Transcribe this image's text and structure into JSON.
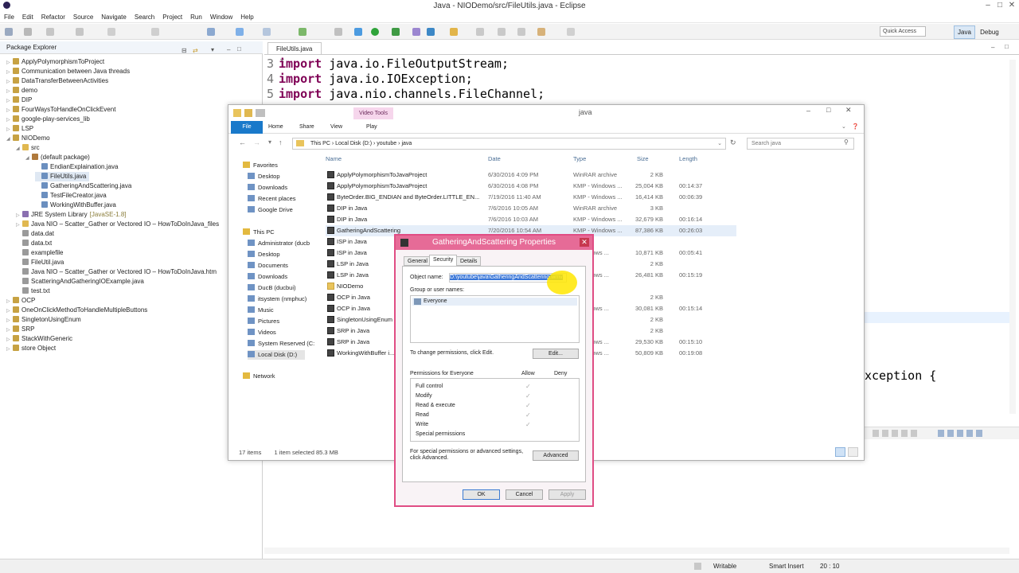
{
  "window": {
    "title": "Java - NIODemo/src/FileUtils.java - Eclipse"
  },
  "menu": [
    "File",
    "Edit",
    "Refactor",
    "Source",
    "Navigate",
    "Search",
    "Project",
    "Run",
    "Window",
    "Help"
  ],
  "quick_access": "Quick Access",
  "perspectives": {
    "java": "Java",
    "debug": "Debug"
  },
  "package_explorer": {
    "title": "Package Explorer",
    "items": [
      {
        "label": "ApplyPolymorphismToProject",
        "depth": 0,
        "kind": "project"
      },
      {
        "label": "Communication between Java threads",
        "depth": 0,
        "kind": "project"
      },
      {
        "label": "DataTransferBetweenActivities",
        "depth": 0,
        "kind": "project"
      },
      {
        "label": "demo",
        "depth": 0,
        "kind": "project"
      },
      {
        "label": "DIP",
        "depth": 0,
        "kind": "project"
      },
      {
        "label": "FourWaysToHandleOnClickEvent",
        "depth": 0,
        "kind": "project"
      },
      {
        "label": "google-play-services_lib",
        "depth": 0,
        "kind": "project"
      },
      {
        "label": "LSP",
        "depth": 0,
        "kind": "project"
      },
      {
        "label": "NIODemo",
        "depth": 0,
        "kind": "project"
      },
      {
        "label": "src",
        "depth": 1,
        "kind": "folder"
      },
      {
        "label": "(default package)",
        "depth": 2,
        "kind": "package"
      },
      {
        "label": "EndianExplaination.java",
        "depth": 3,
        "kind": "java"
      },
      {
        "label": "FileUtils.java",
        "depth": 3,
        "kind": "java",
        "selected": true
      },
      {
        "label": "GatheringAndScattering.java",
        "depth": 3,
        "kind": "java"
      },
      {
        "label": "TestFileCreator.java",
        "depth": 3,
        "kind": "java"
      },
      {
        "label": "WorkingWithBuffer.java",
        "depth": 3,
        "kind": "java"
      },
      {
        "label": "JRE System Library",
        "suffix": "[JavaSE-1.8]",
        "depth": 1,
        "kind": "lib"
      },
      {
        "label": "Java NIO – Scatter_Gather or Vectored IO – HowToDoInJava_files",
        "depth": 1,
        "kind": "folder"
      },
      {
        "label": "data.dat",
        "depth": 1,
        "kind": "file"
      },
      {
        "label": "data.txt",
        "depth": 1,
        "kind": "file"
      },
      {
        "label": "examplefile",
        "depth": 1,
        "kind": "file"
      },
      {
        "label": "FileUtil.java",
        "depth": 1,
        "kind": "file"
      },
      {
        "label": "Java NIO – Scatter_Gather or Vectored IO – HowToDoInJava.htm",
        "depth": 1,
        "kind": "file"
      },
      {
        "label": "ScatteringAndGatheringIOExample.java",
        "depth": 1,
        "kind": "file"
      },
      {
        "label": "test.txt",
        "depth": 1,
        "kind": "file"
      },
      {
        "label": "OCP",
        "depth": 0,
        "kind": "project"
      },
      {
        "label": "OneOnClickMethodToHandleMultipleButtons",
        "depth": 0,
        "kind": "project"
      },
      {
        "label": "SingletonUsingEnum",
        "depth": 0,
        "kind": "project"
      },
      {
        "label": "SRP",
        "depth": 0,
        "kind": "project"
      },
      {
        "label": "StackWithGeneric",
        "depth": 0,
        "kind": "project"
      },
      {
        "label": "store Object",
        "depth": 0,
        "kind": "project"
      }
    ]
  },
  "editor": {
    "tab": "FileUtils.java",
    "lines": [
      {
        "n": "3",
        "kw": "import",
        "rest": " java.io.FileOutputStream;"
      },
      {
        "n": "4",
        "kw": "import",
        "rest": " java.io.IOException;"
      },
      {
        "n": "5",
        "kw": "import",
        "rest": " java.nio.channels.FileChannel;"
      }
    ],
    "fragment": "xception {"
  },
  "status": {
    "mode": "Writable",
    "insert": "Smart Insert",
    "position": "20 : 10"
  },
  "explorer": {
    "title": "java",
    "context_tab": "Video Tools",
    "ribbon": [
      "File",
      "Home",
      "Share",
      "View",
      "Play"
    ],
    "path": [
      "This PC",
      "Local Disk (D:)",
      "youtube",
      "java"
    ],
    "search_placeholder": "Search java",
    "columns": [
      "Name",
      "Date",
      "Type",
      "Size",
      "Length"
    ],
    "nav": [
      {
        "label": "Favorites",
        "depth": 0
      },
      {
        "label": "Desktop",
        "depth": 1
      },
      {
        "label": "Downloads",
        "depth": 1
      },
      {
        "label": "Recent places",
        "depth": 1
      },
      {
        "label": "Google Drive",
        "depth": 1
      },
      {
        "label": "This PC",
        "depth": 0
      },
      {
        "label": "Administrator (ducb",
        "depth": 1
      },
      {
        "label": "Desktop",
        "depth": 1
      },
      {
        "label": "Documents",
        "depth": 1
      },
      {
        "label": "Downloads",
        "depth": 1
      },
      {
        "label": "DucB (ducbui)",
        "depth": 1
      },
      {
        "label": "itsystem (nmphuc)",
        "depth": 1
      },
      {
        "label": "Music",
        "depth": 1
      },
      {
        "label": "Pictures",
        "depth": 1
      },
      {
        "label": "Videos",
        "depth": 1
      },
      {
        "label": "System Reserved (C:",
        "depth": 1
      },
      {
        "label": "Local Disk (D:)",
        "depth": 1
      },
      {
        "label": "Network",
        "depth": 0
      }
    ],
    "files": [
      {
        "name": "ApplyPolymorphismToJavaProject",
        "date": "6/30/2016 4:09 PM",
        "type": "WinRAR archive",
        "size": "2 KB",
        "length": ""
      },
      {
        "name": "ApplyPolymorphismToJavaProject",
        "date": "6/30/2016 4:08 PM",
        "type": "KMP - Windows ...",
        "size": "25,004 KB",
        "length": "00:14:37"
      },
      {
        "name": "ByteOrder.BIG_ENDIAN and ByteOrder.LITTLE_EN...",
        "date": "7/19/2016 11:40 AM",
        "type": "KMP - Windows ...",
        "size": "16,414 KB",
        "length": "00:06:39"
      },
      {
        "name": "DIP in Java",
        "date": "7/6/2016 10:05 AM",
        "type": "WinRAR archive",
        "size": "3 KB",
        "length": ""
      },
      {
        "name": "DIP in Java",
        "date": "7/6/2016 10:03 AM",
        "type": "KMP - Windows ...",
        "size": "32,679 KB",
        "length": "00:16:14"
      },
      {
        "name": "GatheringAndScattering",
        "date": "7/20/2016 10:54 AM",
        "type": "KMP - Windows ...",
        "size": "87,386 KB",
        "length": "00:26:03"
      },
      {
        "name": "ISP in Java",
        "date": "",
        "type": "...rchive",
        "size": "",
        "length": ""
      },
      {
        "name": "ISP in Java",
        "date": "",
        "type": "...Windows ...",
        "size": "10,871 KB",
        "length": "00:05:41"
      },
      {
        "name": "LSP in Java",
        "date": "",
        "type": "...rchive",
        "size": "2 KB",
        "length": ""
      },
      {
        "name": "LSP in Java",
        "date": "",
        "type": "...Windows ...",
        "size": "26,481 KB",
        "length": "00:15:19"
      },
      {
        "name": "NIODemo",
        "date": "",
        "type": "...lder",
        "size": "",
        "length": ""
      },
      {
        "name": "OCP in Java",
        "date": "",
        "type": "...rchive",
        "size": "2 KB",
        "length": ""
      },
      {
        "name": "OCP in Java",
        "date": "",
        "type": "...Windows ...",
        "size": "30,081 KB",
        "length": "00:15:14"
      },
      {
        "name": "SingletonUsingEnum",
        "date": "",
        "type": "...rchive",
        "size": "2 KB",
        "length": ""
      },
      {
        "name": "SRP in Java",
        "date": "",
        "type": "...rchive",
        "size": "2 KB",
        "length": ""
      },
      {
        "name": "SRP in Java",
        "date": "",
        "type": "...Windows ...",
        "size": "29,530 KB",
        "length": "00:15:10"
      },
      {
        "name": "WorkingWithBuffer i...",
        "date": "",
        "type": "...Windows ...",
        "size": "50,809 KB",
        "length": "00:19:08"
      }
    ],
    "status_items": "17 items",
    "status_selected": "1 item selected  85.3 MB"
  },
  "dialog": {
    "title": "GatheringAndScattering Properties",
    "tabs": [
      "General",
      "Security",
      "Details"
    ],
    "object_label": "Object name:",
    "object_value": "D:\\youtube\\java\\GatheringAndScattering.wmv",
    "group_label": "Group or user names:",
    "groups": [
      "Everyone"
    ],
    "change_text": "To change permissions, click Edit.",
    "edit_btn": "Edit...",
    "perm_label": "Permissions for Everyone",
    "allow": "Allow",
    "deny": "Deny",
    "permissions": [
      {
        "name": "Full control",
        "allow": true
      },
      {
        "name": "Modify",
        "allow": true
      },
      {
        "name": "Read & execute",
        "allow": true
      },
      {
        "name": "Read",
        "allow": true
      },
      {
        "name": "Write",
        "allow": true
      },
      {
        "name": "Special permissions",
        "allow": false
      }
    ],
    "special_text_1": "For special permissions or advanced settings,",
    "special_text_2": "click Advanced.",
    "advanced_btn": "Advanced",
    "ok": "OK",
    "cancel": "Cancel",
    "apply": "Apply"
  },
  "colors": {
    "accent": "#1979ca",
    "dialog_border": "#e04d84",
    "keyword": "#7f0055"
  }
}
